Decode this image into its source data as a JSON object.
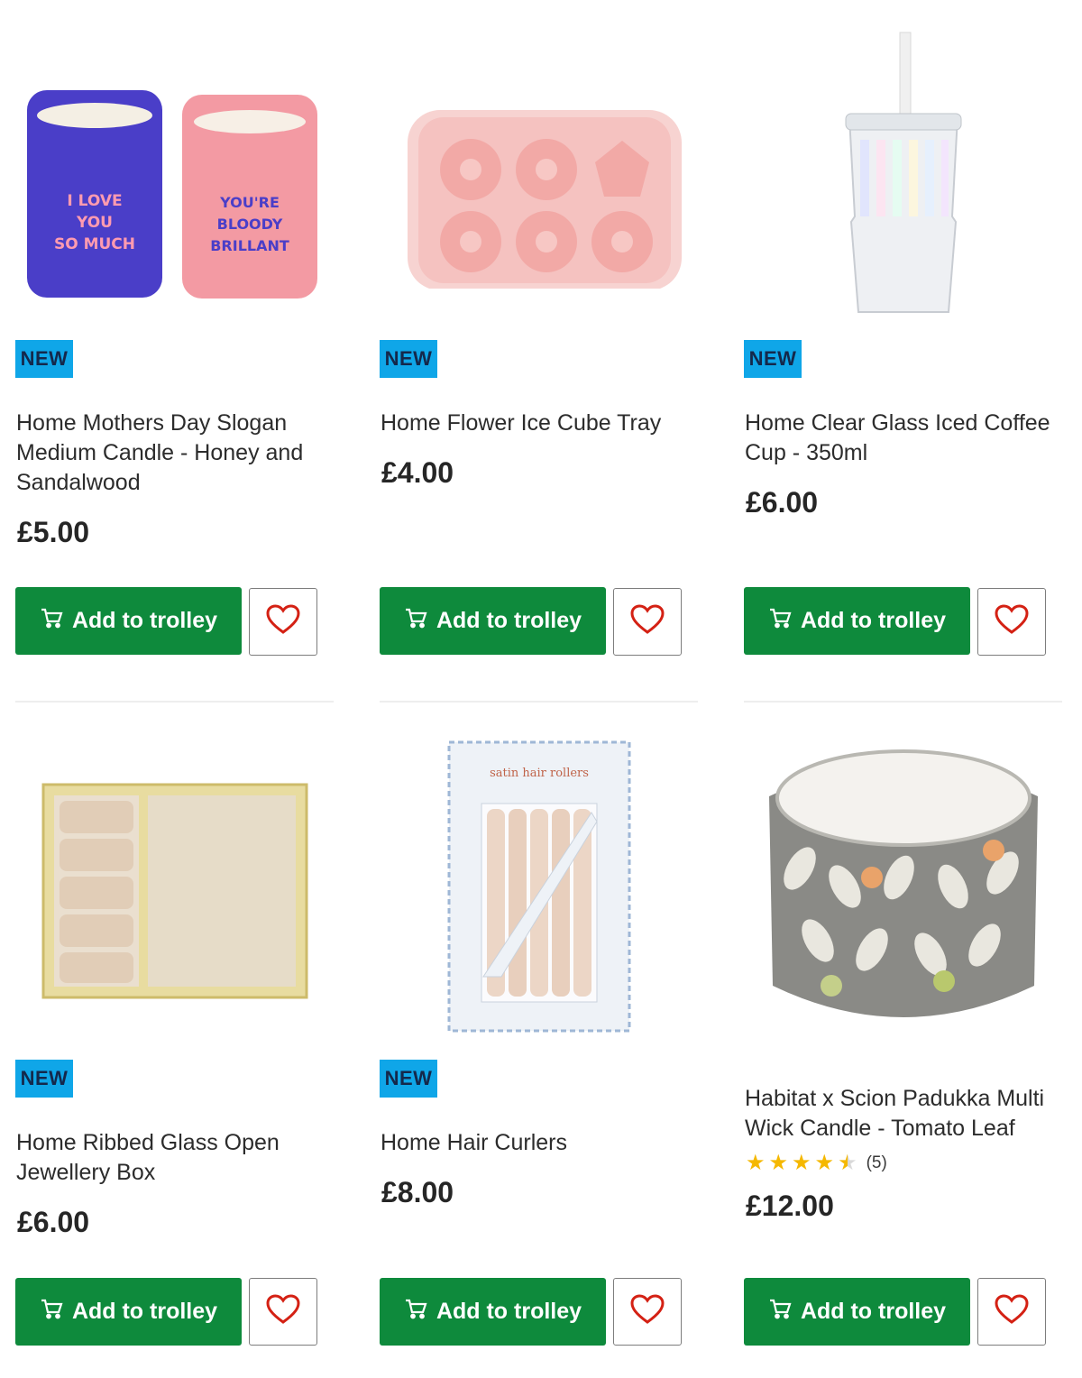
{
  "products": [
    {
      "badge": "NEW",
      "title": "Home Mothers Day Slogan Medium Candle - Honey and Sandalwood",
      "price": "£5.00",
      "add_label": "Add to trolley",
      "candle_left_text": "I LOVE YOU SO MUCH",
      "candle_right_text": "YOU'RE BLOODY BRILLANT"
    },
    {
      "badge": "NEW",
      "title": "Home Flower Ice Cube Tray",
      "price": "£4.00",
      "add_label": "Add to trolley"
    },
    {
      "badge": "NEW",
      "title": "Home Clear Glass Iced Coffee Cup - 350ml",
      "price": "£6.00",
      "add_label": "Add to trolley"
    },
    {
      "badge": "NEW",
      "title": "Home Ribbed Glass Open Jewellery Box",
      "price": "£6.00",
      "add_label": "Add to trolley"
    },
    {
      "badge": "NEW",
      "title": "Home Hair Curlers",
      "price": "£8.00",
      "add_label": "Add to trolley",
      "box_text": "satin hair rollers"
    },
    {
      "title": "Habitat x Scion Padukka Multi Wick Candle - Tomato Leaf",
      "price": "£12.00",
      "add_label": "Add to trolley",
      "rating": 4.5,
      "rating_count": "(5)"
    }
  ],
  "colors": {
    "add_button": "#0e8a3c",
    "badge": "#0fa6e8",
    "heart": "#d42114",
    "star": "#f5b800"
  },
  "icons": {
    "trolley": "trolley-icon",
    "favourite": "heart-icon",
    "star": "star-icon"
  }
}
